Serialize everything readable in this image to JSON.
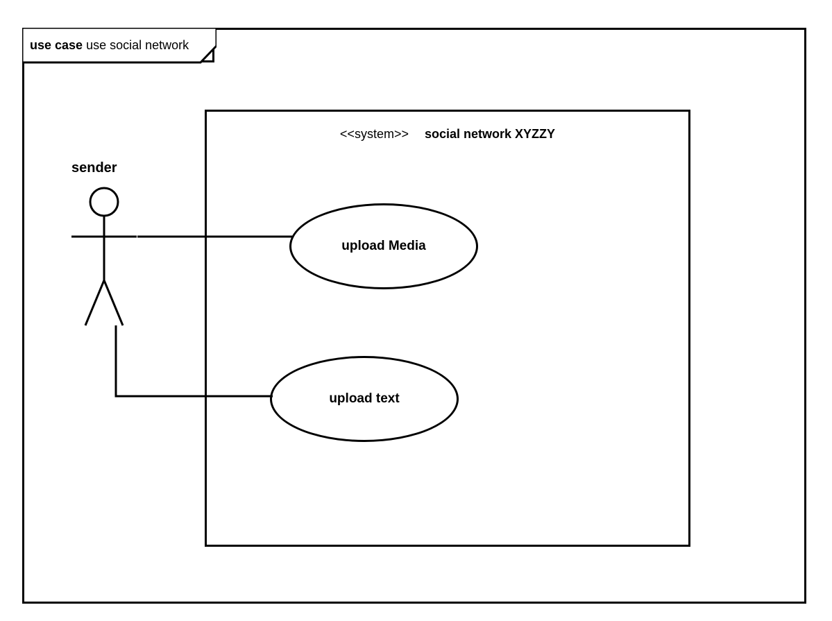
{
  "diagram": {
    "title_prefix": "use case",
    "title_name": "use social network",
    "system_stereotype": "<<system>>",
    "system_name": "social network XYZZY",
    "actor": {
      "name": "sender"
    },
    "usecases": [
      {
        "label": "upload Media"
      },
      {
        "label": "upload text"
      }
    ],
    "associations": [
      {
        "from": "sender",
        "to": "upload Media"
      },
      {
        "from": "sender",
        "to": "upload text"
      }
    ]
  }
}
